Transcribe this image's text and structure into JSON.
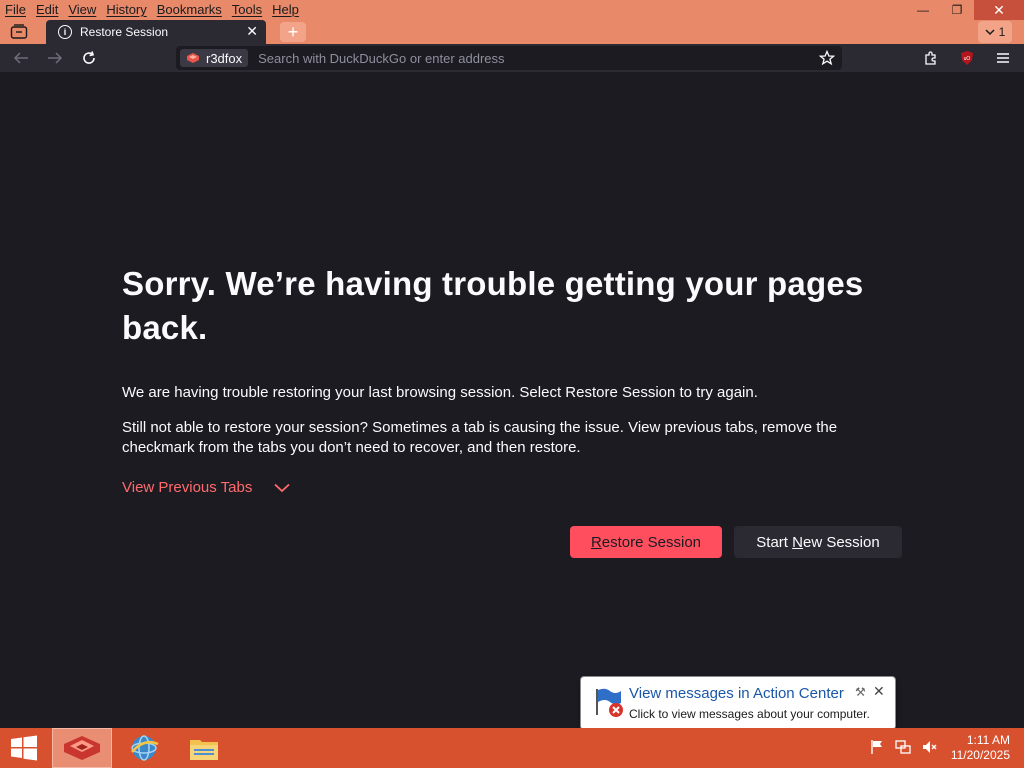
{
  "menubar": {
    "file": "File",
    "edit": "Edit",
    "view": "View",
    "history": "History",
    "bookmarks": "Bookmarks",
    "tools": "Tools",
    "help": "Help"
  },
  "window": {
    "minimize_glyph": "—",
    "restore_glyph": "❐",
    "close_glyph": "✕"
  },
  "tabs": {
    "active_title": "Restore Session",
    "close_glyph": "✕",
    "new_tab_glyph": "+",
    "all_tabs_count": "1"
  },
  "navbar": {
    "identity_label": "r3dfox",
    "search_placeholder": "Search with DuckDuckGo or enter address",
    "search_value": ""
  },
  "content": {
    "headline": "Sorry. We’re having trouble getting your pages back.",
    "paragraph1": "We are having trouble restoring your last browsing session. Select Restore Session to try again.",
    "paragraph2": "Still not able to restore your session? Sometimes a tab is causing the issue. View previous tabs, remove the checkmark from the tabs you don’t need to recover, and then restore.",
    "view_previous_tabs": "View Previous Tabs",
    "restore_button": {
      "accesskey": "R",
      "rest": "estore Session"
    },
    "new_session_button": {
      "pre": "Start ",
      "accesskey": "N",
      "rest": "ew Session"
    }
  },
  "notification": {
    "title": "View messages in Action Center",
    "body": "Click to view messages about your computer."
  },
  "taskbar": {
    "time": "1:11 AM",
    "date": "11/20/2025"
  },
  "colors": {
    "accent_orange": "#e8896a",
    "taskbar": "#d8512f",
    "content_bg": "#1c1b22",
    "toolbar_bg": "#2b2a33",
    "primary_button": "#ff4f5e",
    "link_red": "#ff6b6b"
  },
  "icons": {
    "tab_list": "tab-list-icon",
    "tab_info": "info-icon",
    "back": "back-arrow-icon",
    "forward": "forward-arrow-icon",
    "reload": "reload-icon",
    "identity": "r3dfox-logo-icon",
    "bookmark": "star-icon",
    "extensions": "puzzle-icon",
    "ublock": "ublock-origin-icon",
    "menu": "hamburger-menu-icon",
    "chevron": "chevron-down-icon",
    "start": "windows-logo-icon",
    "action_center_flag": "action-center-flag-icon"
  }
}
